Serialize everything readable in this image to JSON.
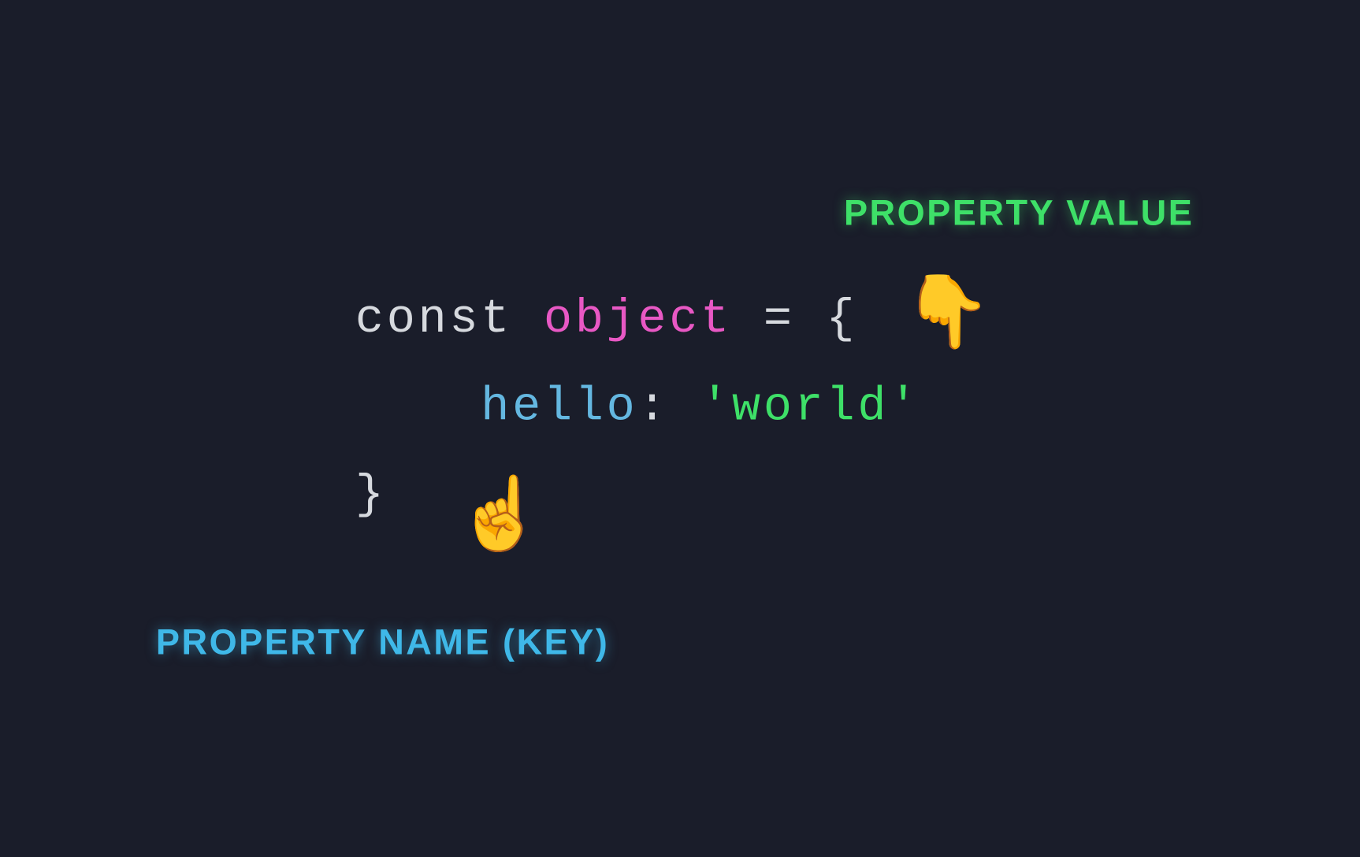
{
  "labels": {
    "value": "PROPERTY VALUE",
    "key": "PROPERTY NAME (KEY)"
  },
  "code": {
    "keyword": "const",
    "identifier": "object",
    "equals": " = ",
    "braceOpen": "{",
    "indent": "    ",
    "propName": "hello",
    "colonSep": ": ",
    "propValue": "'world'",
    "braceClose": "}"
  },
  "emoji": {
    "pointDown": "👇",
    "pointUp": "☝️"
  }
}
